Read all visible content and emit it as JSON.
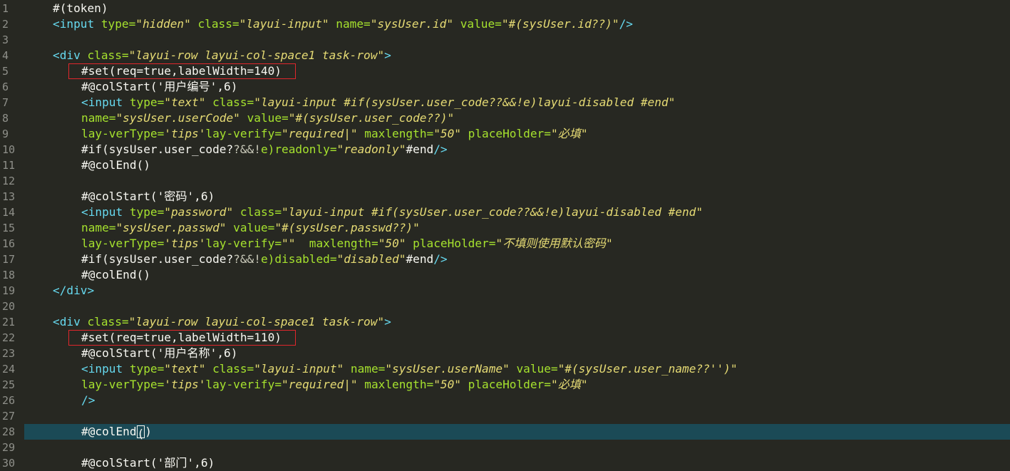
{
  "lines": [
    {
      "n": "1",
      "indent": 1,
      "tokens": [
        {
          "t": "#(token)",
          "c": "plain"
        }
      ]
    },
    {
      "n": "2",
      "indent": 1,
      "tokens": [
        {
          "t": "<input",
          "c": "tag"
        },
        {
          "t": " type=",
          "c": "attr"
        },
        {
          "t": "\"hidden\"",
          "c": "str"
        },
        {
          "t": " class=",
          "c": "attr"
        },
        {
          "t": "\"layui-input\"",
          "c": "str"
        },
        {
          "t": " name=",
          "c": "attr"
        },
        {
          "t": "\"sysUser.id\"",
          "c": "str"
        },
        {
          "t": " value=",
          "c": "attr"
        },
        {
          "t": "\"#(sysUser.id??)\"",
          "c": "str"
        },
        {
          "t": "/>",
          "c": "tag"
        }
      ]
    },
    {
      "n": "3",
      "indent": 1,
      "tokens": []
    },
    {
      "n": "4",
      "indent": 1,
      "tokens": [
        {
          "t": "<div",
          "c": "tag"
        },
        {
          "t": " class=",
          "c": "attr"
        },
        {
          "t": "\"layui-row layui-col-space1 task-row\"",
          "c": "str"
        },
        {
          "t": ">",
          "c": "tag"
        }
      ]
    },
    {
      "n": "5",
      "indent": 2,
      "tokens": [
        {
          "t": "#set(req=true,labelWidth=140)",
          "c": "plain"
        }
      ]
    },
    {
      "n": "6",
      "indent": 2,
      "tokens": [
        {
          "t": "#@colStart('用户编号',6)",
          "c": "plain"
        }
      ]
    },
    {
      "n": "7",
      "indent": 2,
      "tokens": [
        {
          "t": "<input",
          "c": "tag"
        },
        {
          "t": " type=",
          "c": "attr"
        },
        {
          "t": "\"text\"",
          "c": "str"
        },
        {
          "t": " class=",
          "c": "attr"
        },
        {
          "t": "\"layui-input #if(sysUser.user_code??&&!e)layui-disabled #end\"",
          "c": "str"
        }
      ]
    },
    {
      "n": "8",
      "indent": 2,
      "tokens": [
        {
          "t": "name=",
          "c": "attr"
        },
        {
          "t": "\"sysUser.userCode\"",
          "c": "str"
        },
        {
          "t": " value=",
          "c": "attr"
        },
        {
          "t": "\"#(sysUser.user_code??)\"",
          "c": "str"
        }
      ]
    },
    {
      "n": "9",
      "indent": 2,
      "tokens": [
        {
          "t": "lay-verType=",
          "c": "attr"
        },
        {
          "t": "'tips'",
          "c": "str"
        },
        {
          "t": "lay-verify=",
          "c": "attr"
        },
        {
          "t": "\"required|\"",
          "c": "str"
        },
        {
          "t": " maxlength=",
          "c": "attr"
        },
        {
          "t": "\"50\"",
          "c": "str"
        },
        {
          "t": " placeHolder=",
          "c": "attr"
        },
        {
          "t": "\"必填\"",
          "c": "str"
        }
      ]
    },
    {
      "n": "10",
      "indent": 2,
      "tokens": [
        {
          "t": "#if(sysUser.user_code?",
          "c": "plain"
        },
        {
          "t": "?&&!",
          "c": "dim"
        },
        {
          "t": "e)readonly=",
          "c": "attr"
        },
        {
          "t": "\"readonly\"",
          "c": "str"
        },
        {
          "t": "#end",
          "c": "plain"
        },
        {
          "t": "/>",
          "c": "tag"
        }
      ]
    },
    {
      "n": "11",
      "indent": 2,
      "tokens": [
        {
          "t": "#@colEnd()",
          "c": "plain"
        }
      ]
    },
    {
      "n": "12",
      "indent": 2,
      "tokens": []
    },
    {
      "n": "13",
      "indent": 2,
      "tokens": [
        {
          "t": "#@colStart('密码',6)",
          "c": "plain"
        }
      ]
    },
    {
      "n": "14",
      "indent": 2,
      "tokens": [
        {
          "t": "<input",
          "c": "tag"
        },
        {
          "t": " type=",
          "c": "attr"
        },
        {
          "t": "\"password\"",
          "c": "str"
        },
        {
          "t": " class=",
          "c": "attr"
        },
        {
          "t": "\"layui-input #if(sysUser.user_code??&&!e)layui-disabled #end\"",
          "c": "str"
        }
      ]
    },
    {
      "n": "15",
      "indent": 2,
      "tokens": [
        {
          "t": "name=",
          "c": "attr"
        },
        {
          "t": "\"sysUser.passwd\"",
          "c": "str"
        },
        {
          "t": " value=",
          "c": "attr"
        },
        {
          "t": "\"#(sysUser.passwd??)\"",
          "c": "str"
        }
      ]
    },
    {
      "n": "16",
      "indent": 2,
      "tokens": [
        {
          "t": "lay-verType=",
          "c": "attr"
        },
        {
          "t": "'tips'",
          "c": "str"
        },
        {
          "t": "lay-verify=",
          "c": "attr"
        },
        {
          "t": "\"\"",
          "c": "str"
        },
        {
          "t": "  maxlength=",
          "c": "attr"
        },
        {
          "t": "\"50\"",
          "c": "str"
        },
        {
          "t": " placeHolder=",
          "c": "attr"
        },
        {
          "t": "\"不填则使用默认密码\"",
          "c": "str"
        }
      ]
    },
    {
      "n": "17",
      "indent": 2,
      "tokens": [
        {
          "t": "#if(sysUser.user_code?",
          "c": "plain"
        },
        {
          "t": "?&&!",
          "c": "dim"
        },
        {
          "t": "e)disabled=",
          "c": "attr"
        },
        {
          "t": "\"disabled\"",
          "c": "str"
        },
        {
          "t": "#end",
          "c": "plain"
        },
        {
          "t": "/>",
          "c": "tag"
        }
      ]
    },
    {
      "n": "18",
      "indent": 2,
      "tokens": [
        {
          "t": "#@colEnd()",
          "c": "plain"
        }
      ]
    },
    {
      "n": "19",
      "indent": 1,
      "tokens": [
        {
          "t": "</div>",
          "c": "tag"
        }
      ]
    },
    {
      "n": "20",
      "indent": 1,
      "tokens": []
    },
    {
      "n": "21",
      "indent": 1,
      "tokens": [
        {
          "t": "<div",
          "c": "tag"
        },
        {
          "t": " class=",
          "c": "attr"
        },
        {
          "t": "\"layui-row layui-col-space1 task-row\"",
          "c": "str"
        },
        {
          "t": ">",
          "c": "tag"
        }
      ]
    },
    {
      "n": "22",
      "indent": 2,
      "tokens": [
        {
          "t": "#set(req=true,labelWidth=110)",
          "c": "plain"
        }
      ]
    },
    {
      "n": "23",
      "indent": 2,
      "tokens": [
        {
          "t": "#@colStart('用户名称',6)",
          "c": "plain"
        }
      ]
    },
    {
      "n": "24",
      "indent": 2,
      "tokens": [
        {
          "t": "<input",
          "c": "tag"
        },
        {
          "t": " type=",
          "c": "attr"
        },
        {
          "t": "\"text\"",
          "c": "str"
        },
        {
          "t": " class=",
          "c": "attr"
        },
        {
          "t": "\"layui-input\"",
          "c": "str"
        },
        {
          "t": " name=",
          "c": "attr"
        },
        {
          "t": "\"sysUser.userName\"",
          "c": "str"
        },
        {
          "t": " value=",
          "c": "attr"
        },
        {
          "t": "\"#(sysUser.user_name??'')\"",
          "c": "str"
        }
      ]
    },
    {
      "n": "25",
      "indent": 2,
      "tokens": [
        {
          "t": "lay-verType=",
          "c": "attr"
        },
        {
          "t": "'tips'",
          "c": "str"
        },
        {
          "t": "lay-verify=",
          "c": "attr"
        },
        {
          "t": "\"required|\"",
          "c": "str"
        },
        {
          "t": " maxlength=",
          "c": "attr"
        },
        {
          "t": "\"50\"",
          "c": "str"
        },
        {
          "t": " placeHolder=",
          "c": "attr"
        },
        {
          "t": "\"必填\"",
          "c": "str"
        }
      ]
    },
    {
      "n": "26",
      "indent": 2,
      "tokens": [
        {
          "t": "/>",
          "c": "tag"
        }
      ]
    },
    {
      "n": "27",
      "indent": 2,
      "tokens": []
    },
    {
      "n": "28",
      "indent": 2,
      "active": true,
      "tokens": [
        {
          "t": "#@colEnd",
          "c": "plain"
        },
        {
          "t": "(",
          "c": "plain",
          "cursor": true
        },
        {
          "t": ")",
          "c": "plain"
        }
      ]
    },
    {
      "n": "29",
      "indent": 2,
      "tokens": []
    },
    {
      "n": "30",
      "indent": 2,
      "tokens": [
        {
          "t": "#@colStart('部门',6)",
          "c": "plain"
        }
      ]
    }
  ],
  "highlights": [
    {
      "line": "5"
    },
    {
      "line": "22"
    }
  ],
  "colors": {
    "background": "#272822",
    "active_line": "#1b4a56",
    "line_numbers": "#8f908a",
    "tag": "#66d9ef",
    "attribute": "#a6e22e",
    "string": "#e6db74",
    "highlight_box": "#e0262c"
  }
}
